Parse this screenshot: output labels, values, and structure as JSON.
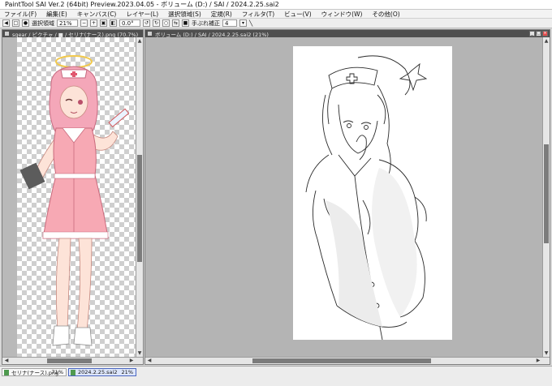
{
  "window": {
    "title": "PaintTool SAI Ver.2 (64bit) Preview.2023.04.05 - ボリューム (D:) / SAI / 2024.2.25.sai2"
  },
  "menu": {
    "items": [
      "ファイル(F)",
      "編集(E)",
      "キャンバス(C)",
      "レイヤー(L)",
      "選択領域(S)",
      "定規(R)",
      "フィルタ(T)",
      "ビュー(V)",
      "ウィンドウ(W)",
      "その他(O)"
    ]
  },
  "toolbar": {
    "selection_label": "選択領域",
    "zoom_value": "21%",
    "rotation_value": "0.0°",
    "stabilizer_label": "手ぶれ補正",
    "stabilizer_value": "4"
  },
  "left_pane": {
    "title": "sgear / ピクチャ / ■ / セリナ(ナース).png (70.7%)"
  },
  "right_pane": {
    "title": "ボリューム (D:) / SAI / 2024.2.25.sai2 (21%)"
  },
  "status_bar": {
    "tabs": [
      {
        "name": "セリナ(ナース).png",
        "zoom": "71%",
        "active": false
      },
      {
        "name": "2024.2.25.sai2",
        "zoom": "21%",
        "active": true
      }
    ]
  }
}
